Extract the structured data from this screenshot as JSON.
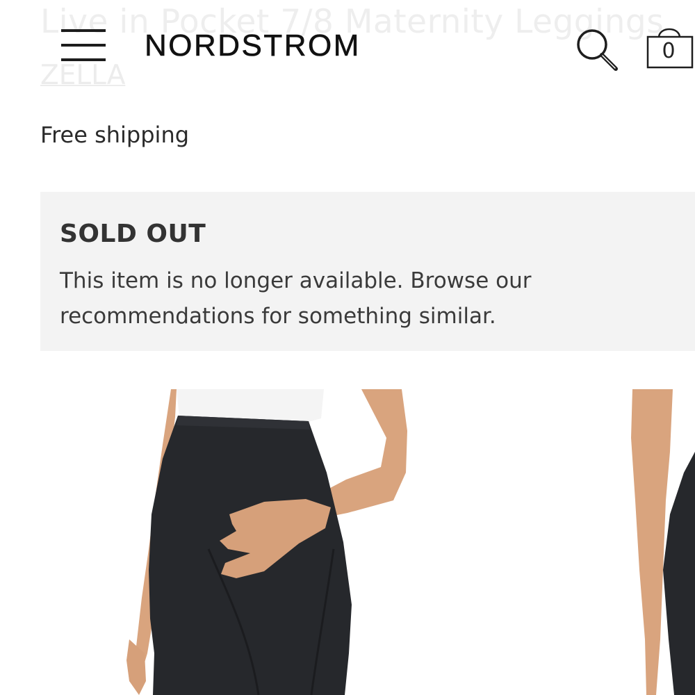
{
  "product": {
    "title": "Live in Pocket 7/8 Maternity Leggings",
    "brand": "ZELLA",
    "shipping": "Free shipping"
  },
  "header": {
    "logo": "NORDSTROM",
    "bag_count": "0",
    "icons": {
      "menu": "hamburger-menu-icon",
      "search": "search-icon",
      "bag": "shopping-bag-icon"
    }
  },
  "sold_out": {
    "title": "SOLD OUT",
    "message": "This item is no longer available. Browse our recommendations for something similar."
  },
  "colors": {
    "leggings": "#26282c",
    "top": "#f4f4f4",
    "skin": "#d9a47e",
    "banner_bg": "#f3f3f3"
  }
}
